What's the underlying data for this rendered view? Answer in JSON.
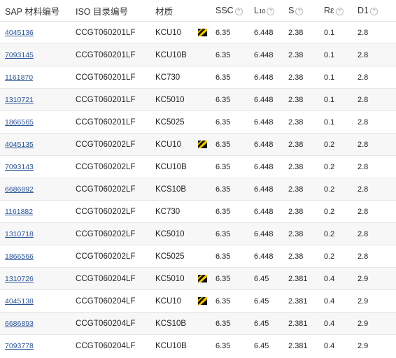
{
  "headers": {
    "sap": "SAP 材料编号",
    "iso": "ISO 目录编号",
    "grade": "材质",
    "ssc": "SSC",
    "l10": "L10",
    "s": "S",
    "re": "Rε",
    "d1": "D1",
    "info_glyph": "?"
  },
  "badge_icon": "black-yellow-diagonal-stripe-icon",
  "rows": [
    {
      "sap": "4045136",
      "iso": "CCGT060201LF",
      "grade": "KCU10",
      "badge": true,
      "ssc": "6.35",
      "l10": "6.448",
      "s": "2.38",
      "re": "0.1",
      "d1": "2.8"
    },
    {
      "sap": "7093145",
      "iso": "CCGT060201LF",
      "grade": "KCU10B",
      "badge": false,
      "ssc": "6.35",
      "l10": "6.448",
      "s": "2.38",
      "re": "0.1",
      "d1": "2.8"
    },
    {
      "sap": "1161870",
      "iso": "CCGT060201LF",
      "grade": "KC730",
      "badge": false,
      "ssc": "6.35",
      "l10": "6.448",
      "s": "2.38",
      "re": "0.1",
      "d1": "2.8"
    },
    {
      "sap": "1310721",
      "iso": "CCGT060201LF",
      "grade": "KC5010",
      "badge": false,
      "ssc": "6.35",
      "l10": "6.448",
      "s": "2.38",
      "re": "0.1",
      "d1": "2.8"
    },
    {
      "sap": "1866565",
      "iso": "CCGT060201LF",
      "grade": "KC5025",
      "badge": false,
      "ssc": "6.35",
      "l10": "6.448",
      "s": "2.38",
      "re": "0.1",
      "d1": "2.8"
    },
    {
      "sap": "4045135",
      "iso": "CCGT060202LF",
      "grade": "KCU10",
      "badge": true,
      "ssc": "6.35",
      "l10": "6.448",
      "s": "2.38",
      "re": "0.2",
      "d1": "2.8"
    },
    {
      "sap": "7093143",
      "iso": "CCGT060202LF",
      "grade": "KCU10B",
      "badge": false,
      "ssc": "6.35",
      "l10": "6.448",
      "s": "2.38",
      "re": "0.2",
      "d1": "2.8"
    },
    {
      "sap": "6686892",
      "iso": "CCGT060202LF",
      "grade": "KCS10B",
      "badge": false,
      "ssc": "6.35",
      "l10": "6.448",
      "s": "2.38",
      "re": "0.2",
      "d1": "2.8"
    },
    {
      "sap": "1161882",
      "iso": "CCGT060202LF",
      "grade": "KC730",
      "badge": false,
      "ssc": "6.35",
      "l10": "6.448",
      "s": "2.38",
      "re": "0.2",
      "d1": "2.8"
    },
    {
      "sap": "1310718",
      "iso": "CCGT060202LF",
      "grade": "KC5010",
      "badge": false,
      "ssc": "6.35",
      "l10": "6.448",
      "s": "2.38",
      "re": "0.2",
      "d1": "2.8"
    },
    {
      "sap": "1866566",
      "iso": "CCGT060202LF",
      "grade": "KC5025",
      "badge": false,
      "ssc": "6.35",
      "l10": "6.448",
      "s": "2.38",
      "re": "0.2",
      "d1": "2.8"
    },
    {
      "sap": "1310726",
      "iso": "CCGT060204LF",
      "grade": "KC5010",
      "badge": true,
      "ssc": "6.35",
      "l10": "6.45",
      "s": "2.381",
      "re": "0.4",
      "d1": "2.9"
    },
    {
      "sap": "4045138",
      "iso": "CCGT060204LF",
      "grade": "KCU10",
      "badge": true,
      "ssc": "6.35",
      "l10": "6.45",
      "s": "2.381",
      "re": "0.4",
      "d1": "2.9"
    },
    {
      "sap": "6686893",
      "iso": "CCGT060204LF",
      "grade": "KCS10B",
      "badge": false,
      "ssc": "6.35",
      "l10": "6.45",
      "s": "2.381",
      "re": "0.4",
      "d1": "2.9"
    },
    {
      "sap": "7093778",
      "iso": "CCGT060204LF",
      "grade": "KCU10B",
      "badge": false,
      "ssc": "6.35",
      "l10": "6.45",
      "s": "2.381",
      "re": "0.4",
      "d1": "2.9"
    }
  ]
}
